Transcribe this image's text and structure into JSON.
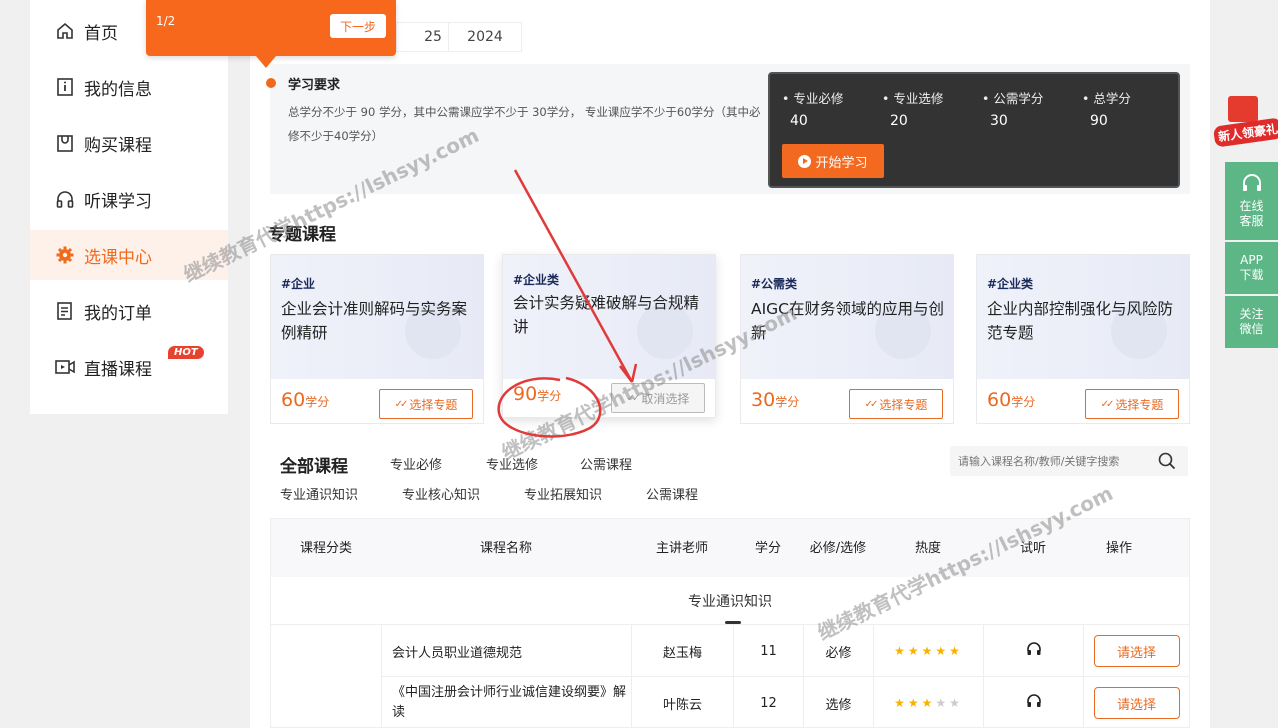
{
  "sidebar": {
    "items": [
      {
        "label": "首页",
        "icon": "home-icon"
      },
      {
        "label": "我的信息",
        "icon": "info-icon"
      },
      {
        "label": "购买课程",
        "icon": "cart-icon"
      },
      {
        "label": "听课学习",
        "icon": "headphones-icon"
      },
      {
        "label": "选课中心",
        "icon": "gear-icon",
        "active": true
      },
      {
        "label": "我的订单",
        "icon": "order-icon"
      },
      {
        "label": "直播课程",
        "icon": "video-icon",
        "badge": "HOT"
      }
    ]
  },
  "guide_tip": {
    "step": "1/2",
    "next_label": "下一步"
  },
  "year_tabs": [
    "25",
    "2024"
  ],
  "requirements": {
    "title": "学习要求",
    "text": "总学分不少于 90 学分，其中公需课应学不少于 30学分， 专业课应学不少于60学分（其中必修不少于40学分）"
  },
  "credit_panel": {
    "items": [
      {
        "label": "• 专业必修",
        "value": "40"
      },
      {
        "label": "• 专业选修",
        "value": "20"
      },
      {
        "label": "• 公需学分",
        "value": "30"
      },
      {
        "label": "• 总学分",
        "value": "90"
      }
    ],
    "start_label": "开始学习"
  },
  "topics": {
    "title": "专题课程",
    "cards": [
      {
        "tag": "#企业",
        "name": "企业会计准则解码与实务案例精研",
        "credits": "60",
        "unit": "学分",
        "button": "选择专题",
        "selected": false
      },
      {
        "tag": "#企业类",
        "name": "会计实务疑难破解与合规精讲",
        "credits": "90",
        "unit": "学分",
        "button": "取消选择",
        "selected": true
      },
      {
        "tag": "#公需类",
        "name": "AIGC在财务领域的应用与创新",
        "credits": "30",
        "unit": "学分",
        "button": "选择专题",
        "selected": false
      },
      {
        "tag": "#企业类",
        "name": "企业内部控制强化与风险防范专题",
        "credits": "60",
        "unit": "学分",
        "button": "选择专题",
        "selected": false
      }
    ]
  },
  "all_courses": {
    "title": "全部课程",
    "filters_row1": [
      "专业必修",
      "专业选修",
      "公需课程"
    ],
    "filters_row2": [
      "专业通识知识",
      "专业核心知识",
      "专业拓展知识",
      "公需课程"
    ],
    "search_placeholder": "请输入课程名称/教师/关键字搜索"
  },
  "table": {
    "headers": [
      "课程分类",
      "课程名称",
      "主讲老师",
      "学分",
      "必修/选修",
      "热度",
      "试听",
      "操作"
    ],
    "group": "专业通识知识",
    "rows": [
      {
        "name": "会计人员职业道德规范",
        "teacher": "赵玉梅",
        "credits": "11",
        "type": "必修",
        "stars": 5,
        "action": "请选择"
      },
      {
        "name": "《中国注册会计师行业诚信建设纲要》解读",
        "teacher": "叶陈云",
        "credits": "12",
        "type": "选修",
        "stars": 3,
        "action": "请选择"
      }
    ]
  },
  "float_bar": {
    "gift_label": "新人领豪礼",
    "items": [
      "在线客服",
      "APP下载",
      "关注微信"
    ]
  },
  "watermark": "继续教育代学https://lshsyy.com",
  "colors": {
    "accent": "#f06a1e",
    "float_green": "#5cb686",
    "annotation_red": "#e03a3a"
  }
}
